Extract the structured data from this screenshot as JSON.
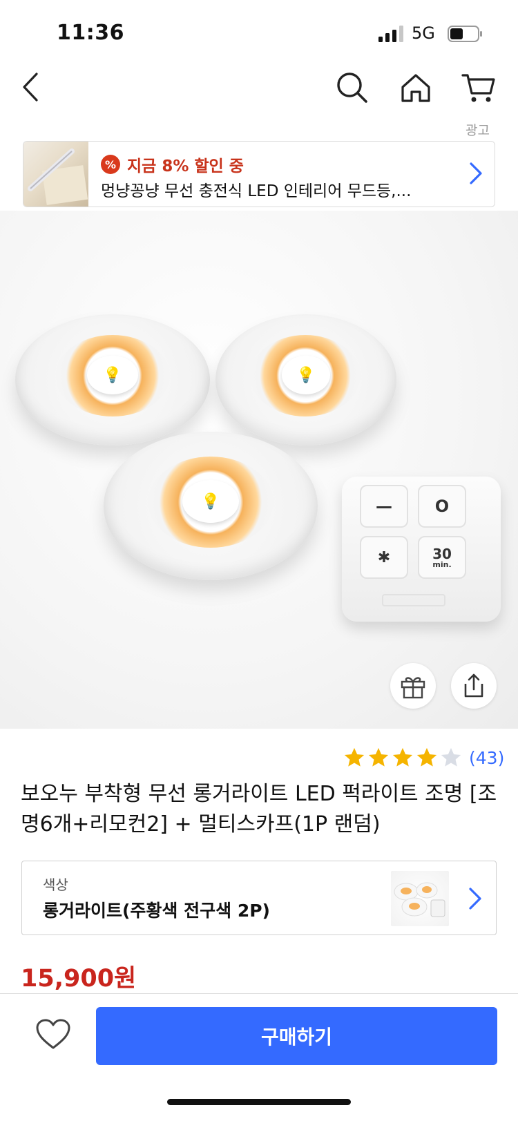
{
  "status_bar": {
    "time": "11:36",
    "network": "5G"
  },
  "nav": {
    "icons": {
      "back": "chevron-left-icon",
      "search": "search-icon",
      "home": "home-icon",
      "cart": "cart-icon"
    }
  },
  "ad": {
    "tag": "광고",
    "badge_icon": "%",
    "badge_text": "지금 8% 할인 중",
    "title": "멍냥꽁냥 무선 충전식 LED 인테리어 무드등,..."
  },
  "hero": {
    "remote_keys": [
      "—",
      "O",
      "✱",
      "30"
    ],
    "remote_key_sub": "min."
  },
  "rating": {
    "stars": 4,
    "max": 5,
    "review_count": "(43)",
    "star_color": "#f5b400",
    "empty_color": "#d9dde5"
  },
  "product": {
    "title": "보오누 부착형 무선 롱거라이트 LED 퍽라이트 조명 [조명6개+리모컨2] + 멀티스카프(1P 랜덤)"
  },
  "option": {
    "label": "색상",
    "value": "롱거라이트(주황색 전구색 2P)"
  },
  "price": "15,900원",
  "bottom": {
    "buy_label": "구매하기",
    "accent": "#346aff"
  }
}
